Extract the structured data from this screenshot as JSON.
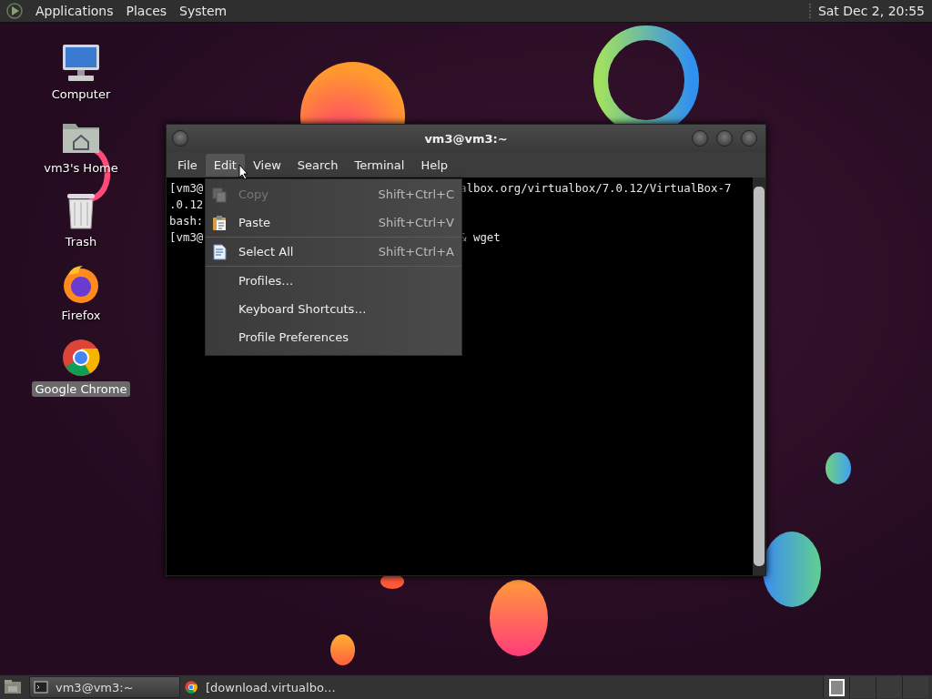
{
  "top_panel": {
    "menus": [
      "Applications",
      "Places",
      "System"
    ],
    "clock": "Sat Dec  2, 20:55"
  },
  "desktop_icons": [
    {
      "label": "Computer",
      "kind": "computer",
      "selected": false
    },
    {
      "label": "vm3's Home",
      "kind": "home",
      "selected": false
    },
    {
      "label": "Trash",
      "kind": "trash",
      "selected": false
    },
    {
      "label": "Firefox",
      "kind": "firefox",
      "selected": false
    },
    {
      "label": "Google Chrome",
      "kind": "chrome",
      "selected": true
    }
  ],
  "terminal": {
    "title": "vm3@vm3:~",
    "menu_bar": [
      {
        "label": "File",
        "selected": false
      },
      {
        "label": "Edit",
        "selected": true
      },
      {
        "label": "View",
        "selected": false
      },
      {
        "label": "Search",
        "selected": false
      },
      {
        "label": "Terminal",
        "selected": false
      },
      {
        "label": "Help",
        "selected": false
      }
    ],
    "lines": [
      {
        "left": "[vm3@",
        "right": "albox.org/virtualbox/7.0.12/VirtualBox-7"
      },
      {
        "left": ".0.12"
      },
      {
        "left": "bash:"
      },
      {
        "left": "[vm3@",
        "right": "& wget"
      }
    ]
  },
  "edit_menu": [
    {
      "kind": "copy",
      "label": "Copy",
      "shortcut": "Shift+Ctrl+C",
      "disabled": true
    },
    {
      "kind": "paste",
      "label": "Paste",
      "shortcut": "Shift+Ctrl+V",
      "disabled": false
    },
    {
      "kind": "separator"
    },
    {
      "kind": "select",
      "label": "Select All",
      "shortcut": "Shift+Ctrl+A",
      "disabled": false
    },
    {
      "kind": "separator"
    },
    {
      "kind": "plain",
      "label": "Profiles…",
      "disabled": false
    },
    {
      "kind": "plain",
      "label": "Keyboard Shortcuts…",
      "disabled": false
    },
    {
      "kind": "plain",
      "label": "Profile Preferences",
      "disabled": false
    }
  ],
  "taskbar": {
    "windows": [
      {
        "label": "vm3@vm3:~",
        "kind": "terminal",
        "selected": true
      },
      {
        "label": "[download.virtualbo…",
        "kind": "chrome",
        "selected": false
      }
    ],
    "workspaces": [
      {
        "selected": true
      },
      {
        "selected": false
      },
      {
        "selected": false
      },
      {
        "selected": false
      }
    ]
  }
}
